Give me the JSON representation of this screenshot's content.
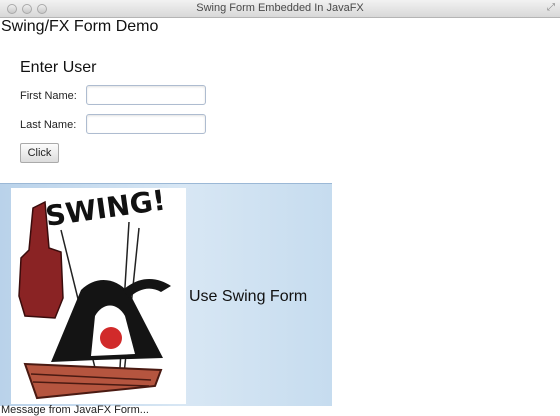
{
  "window": {
    "title": "Swing Form Embedded In JavaFX"
  },
  "app": {
    "title": "Swing/FX Form Demo"
  },
  "form": {
    "heading": "Enter User",
    "first_name_label": "First Name:",
    "first_name_value": "",
    "last_name_label": "Last Name:",
    "last_name_value": "",
    "click_button": "Click"
  },
  "swing_panel": {
    "button_label": "Use Swing Form",
    "image_text": "SWING!",
    "image_icon": "duke-swing-mascot",
    "gradient_colors": [
      "#b9d2ea",
      "#d8e7f4",
      "#c6dcef"
    ]
  },
  "status": {
    "message": "Message from JavaFX Form..."
  }
}
